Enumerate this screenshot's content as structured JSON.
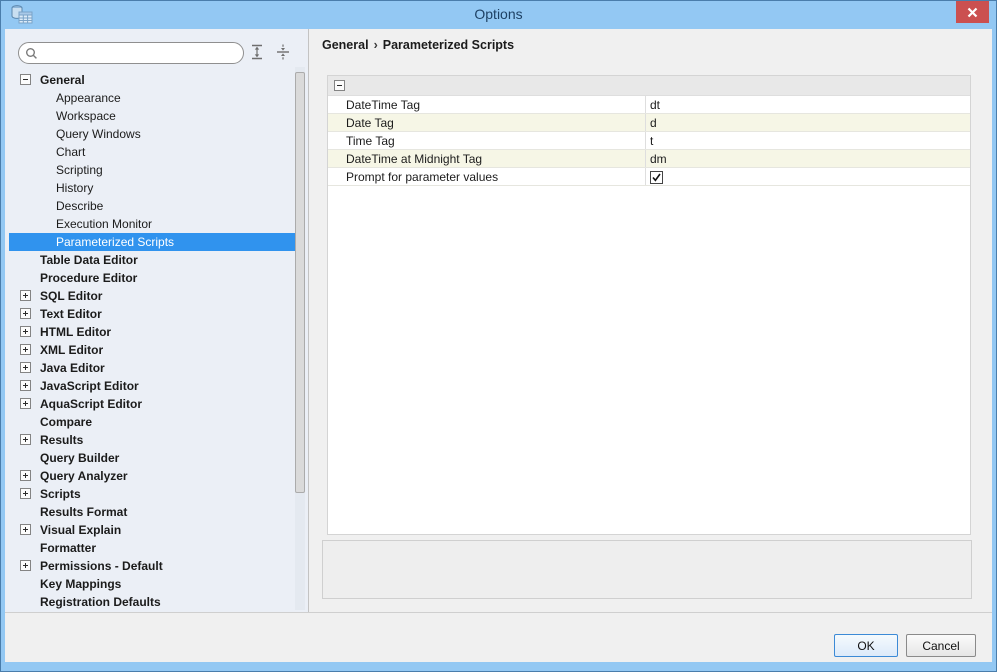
{
  "window": {
    "title": "Options"
  },
  "sidebar": {
    "search": {
      "placeholder": "",
      "value": ""
    },
    "tree": [
      {
        "label": "General",
        "level": 0,
        "bold": true,
        "expander": "minus"
      },
      {
        "label": "Appearance",
        "level": 1
      },
      {
        "label": "Workspace",
        "level": 1
      },
      {
        "label": "Query Windows",
        "level": 1
      },
      {
        "label": "Chart",
        "level": 1
      },
      {
        "label": "Scripting",
        "level": 1
      },
      {
        "label": "History",
        "level": 1
      },
      {
        "label": "Describe",
        "level": 1
      },
      {
        "label": "Execution Monitor",
        "level": 1
      },
      {
        "label": "Parameterized Scripts",
        "level": 1,
        "selected": true
      },
      {
        "label": "Table Data Editor",
        "level": 0,
        "bold": true
      },
      {
        "label": "Procedure Editor",
        "level": 0,
        "bold": true
      },
      {
        "label": "SQL Editor",
        "level": 0,
        "bold": true,
        "expander": "plus"
      },
      {
        "label": "Text Editor",
        "level": 0,
        "bold": true,
        "expander": "plus"
      },
      {
        "label": "HTML Editor",
        "level": 0,
        "bold": true,
        "expander": "plus"
      },
      {
        "label": "XML Editor",
        "level": 0,
        "bold": true,
        "expander": "plus"
      },
      {
        "label": "Java Editor",
        "level": 0,
        "bold": true,
        "expander": "plus"
      },
      {
        "label": "JavaScript Editor",
        "level": 0,
        "bold": true,
        "expander": "plus"
      },
      {
        "label": "AquaScript Editor",
        "level": 0,
        "bold": true,
        "expander": "plus"
      },
      {
        "label": "Compare",
        "level": 0,
        "bold": true
      },
      {
        "label": "Results",
        "level": 0,
        "bold": true,
        "expander": "plus"
      },
      {
        "label": "Query Builder",
        "level": 0,
        "bold": true
      },
      {
        "label": "Query Analyzer",
        "level": 0,
        "bold": true,
        "expander": "plus"
      },
      {
        "label": "Scripts",
        "level": 0,
        "bold": true,
        "expander": "plus"
      },
      {
        "label": "Results Format",
        "level": 0,
        "bold": true
      },
      {
        "label": "Visual Explain",
        "level": 0,
        "bold": true,
        "expander": "plus"
      },
      {
        "label": "Formatter",
        "level": 0,
        "bold": true
      },
      {
        "label": "Permissions - Default",
        "level": 0,
        "bold": true,
        "expander": "plus"
      },
      {
        "label": "Key Mappings",
        "level": 0,
        "bold": true
      },
      {
        "label": "Registration Defaults",
        "level": 0,
        "bold": true
      }
    ]
  },
  "content": {
    "breadcrumb": {
      "items": [
        "General",
        "Parameterized Scripts"
      ],
      "separator": "›"
    },
    "properties": [
      {
        "name": "DateTime Tag",
        "value": "dt",
        "type": "text"
      },
      {
        "name": "Date Tag",
        "value": "d",
        "type": "text"
      },
      {
        "name": "Time Tag",
        "value": "t",
        "type": "text"
      },
      {
        "name": "DateTime at Midnight Tag",
        "value": "dm",
        "type": "text"
      },
      {
        "name": "Prompt for parameter values",
        "value": true,
        "type": "checkbox"
      }
    ]
  },
  "footer": {
    "ok_label": "OK",
    "cancel_label": "Cancel"
  },
  "colors": {
    "titlebar": "#93c8f3",
    "selection": "#3093ee",
    "close_button": "#cb5050",
    "sidebar_bg": "#ebeff6",
    "alt_row": "#f6f6e6"
  }
}
